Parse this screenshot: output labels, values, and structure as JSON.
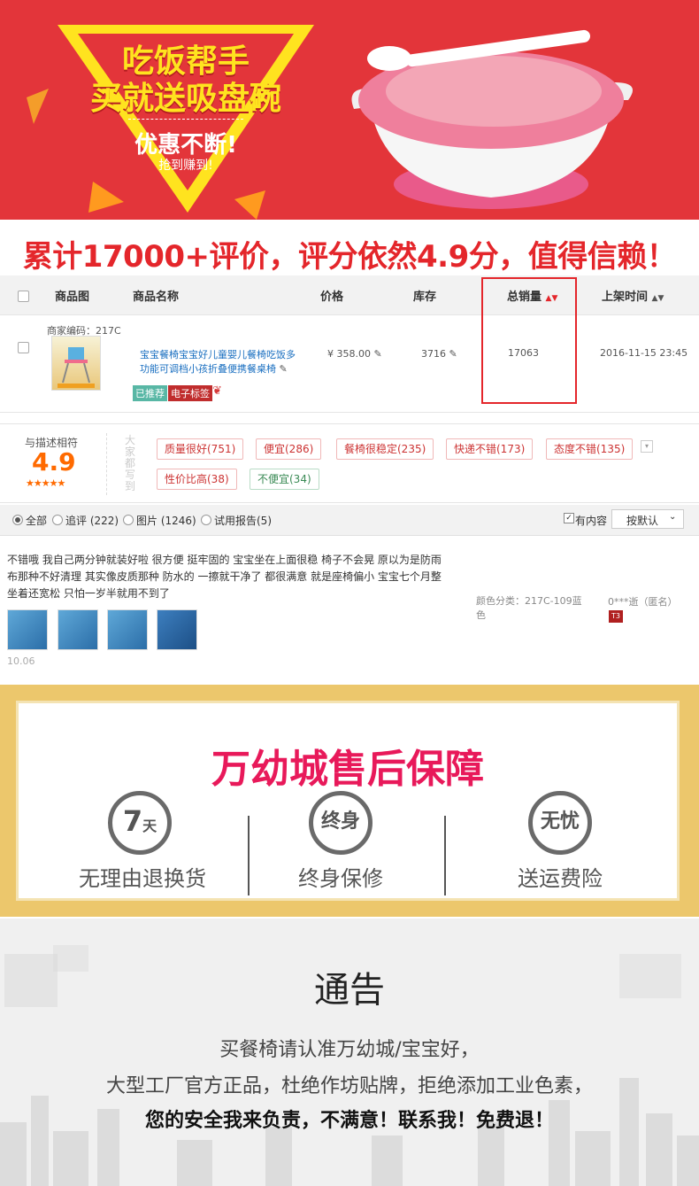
{
  "banner": {
    "title_line1": "吃饭帮手",
    "title_line2": "买就送吸盘碗",
    "promo": "优惠不断!",
    "promo_sub": "抢到赚到!"
  },
  "headline": "累计17000+评价，评分依然4.9分，值得信赖！",
  "table": {
    "headers": {
      "image": "商品图",
      "name": "商品名称",
      "price": "价格",
      "stock": "库存",
      "sales": "总销量",
      "listed": "上架时间"
    },
    "row": {
      "merchant_code": "商家编码：217C",
      "product_name_line1": "宝宝餐椅宝宝好儿童婴儿餐椅吃饭多",
      "product_name_line2": "功能可调档小孩折叠便携餐桌椅",
      "price": "¥ 358.00",
      "stock": "3716",
      "sales": "17063",
      "listed": "2016-11-15 23:45",
      "tag_recommended": "已推荐",
      "tag_label": "电子标签"
    }
  },
  "rating": {
    "label": "与描述相符",
    "score": "4.9",
    "stars": "★★★★★",
    "side_label": "大家都写到",
    "keywords": [
      {
        "text": "质量很好(751)"
      },
      {
        "text": "便宜(286)"
      },
      {
        "text": "餐椅很稳定(235)"
      },
      {
        "text": "快递不错(173)"
      },
      {
        "text": "态度不错(135)"
      },
      {
        "text": "性价比高(38)"
      },
      {
        "text": "不便宜(34)"
      }
    ]
  },
  "filter": {
    "all": "全部",
    "followup": "追评 (222)",
    "images": "图片 (1246)",
    "trial": "试用报告(5)",
    "has_content": "有内容",
    "sort": "按默认"
  },
  "review": {
    "text_line1": "不错哦 我自己两分钟就装好啦 很方便 挺牢固的 宝宝坐在上面很稳 椅子不会晃 原以为是防雨",
    "text_line2": "布那种不好清理 其实像皮质那种 防水的 一擦就干净了 都很满意 就是座椅偏小 宝宝七个月整",
    "text_line3": "坐着还宽松 只怕一岁半就用不到了",
    "date": "10.06",
    "sku_line1": "颜色分类：217C-109蓝",
    "sku_line2": "色",
    "user": "0***逝（匿名）",
    "user_badge": "T3"
  },
  "guarantee": {
    "title": "万幼城售后保障",
    "items": [
      {
        "ring_main": "7",
        "ring_sub": "天",
        "label": "无理由退换货"
      },
      {
        "ring_main": "终身",
        "ring_sub": "",
        "label": "终身保修"
      },
      {
        "ring_main": "无忧",
        "ring_sub": "",
        "label": "送运费险"
      }
    ]
  },
  "notice": {
    "title": "通告",
    "line1": "买餐椅请认准万幼城/宝宝好，",
    "line2": "大型工厂官方正品，杜绝作坊贴牌，拒绝添加工业色素，",
    "line3": "您的安全我来负责，不满意！联系我！免费退！"
  },
  "colors": {
    "banner_red": "#e3353a",
    "headline_red": "#e4262b",
    "rating_orange": "#ff6a00",
    "gold_frame": "#ecc76c"
  }
}
